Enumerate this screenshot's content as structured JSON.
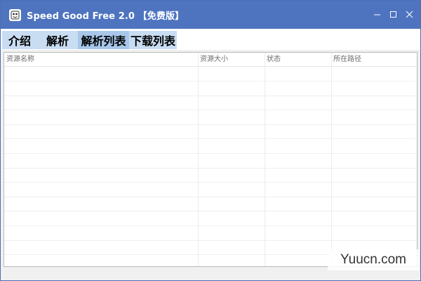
{
  "window": {
    "title": "Speed Good Free 2.0 【免费版】",
    "app_icon": "app-logo-icon",
    "controls": {
      "minimize_icon": "minimize-icon",
      "maximize_icon": "maximize-icon",
      "close_icon": "close-icon"
    },
    "colors": {
      "titlebar": "#4e74c0",
      "tab": "#c8ddf2",
      "tab_active": "#a7c6ea"
    }
  },
  "tabs": [
    {
      "label": "介绍"
    },
    {
      "label": "解析"
    },
    {
      "label": "解析列表",
      "active": true
    },
    {
      "label": "下载列表"
    }
  ],
  "table": {
    "columns": [
      "资源名称",
      "资源大小",
      "状态",
      "所在路径"
    ],
    "rows": []
  },
  "watermark": {
    "text": "Yuucn.com"
  }
}
